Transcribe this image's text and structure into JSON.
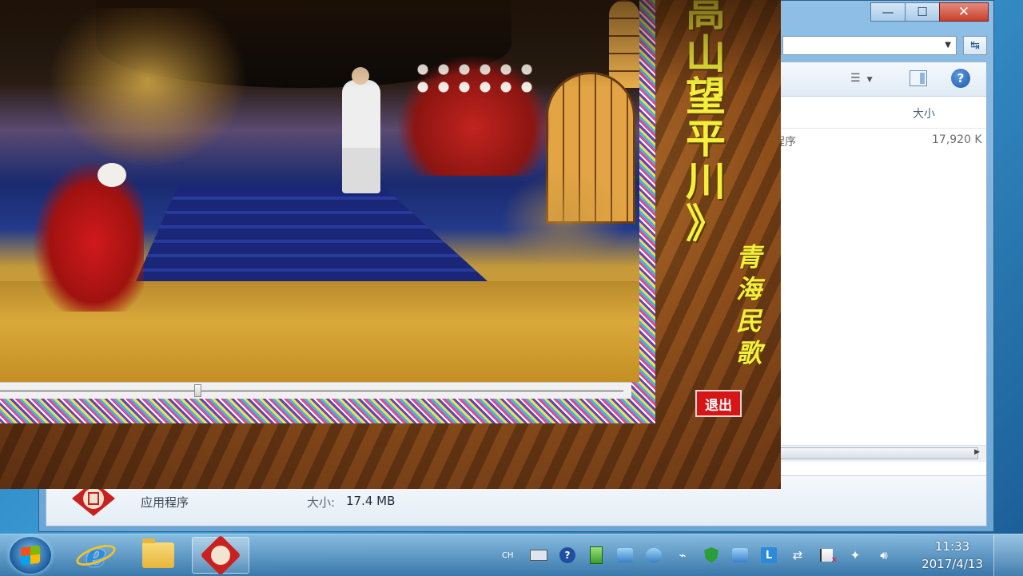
{
  "explorer": {
    "window_controls": {
      "minimize": "—",
      "maximize": "☐",
      "close": "✕"
    },
    "refresh_glyph": "↹",
    "column_header_size": "大小",
    "file_row": {
      "type": "程序",
      "size": "17,920 K"
    },
    "details": {
      "type": "应用程序",
      "size_label": "大小:",
      "size_value": "17.4 MB"
    }
  },
  "player": {
    "title_chars": [
      "高",
      "山",
      "望",
      "平",
      "川",
      "》"
    ],
    "subtitle_chars": [
      "青",
      "海",
      "民",
      "歌"
    ],
    "exit_label": "退出",
    "progress_fraction": 0.32
  },
  "taskbar": {
    "apps": [
      "internet-explorer-icon",
      "folder-icon",
      "song-player-seal-icon"
    ],
    "tray": {
      "lang": "CH",
      "l_label": "L"
    },
    "clock_time": "11:33",
    "clock_date": "2017/4/13"
  }
}
